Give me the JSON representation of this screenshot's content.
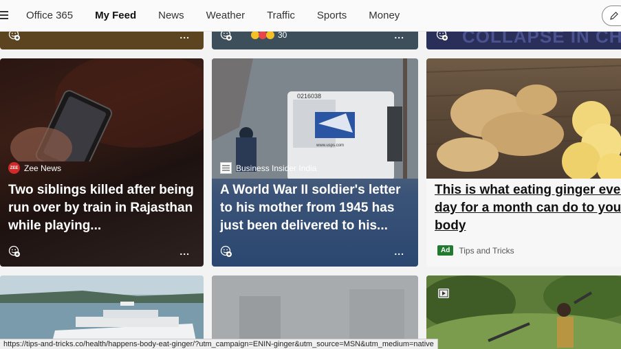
{
  "nav": {
    "items": [
      {
        "label": "Office 365",
        "active": false
      },
      {
        "label": "My Feed",
        "active": true
      },
      {
        "label": "News",
        "active": false
      },
      {
        "label": "Weather",
        "active": false
      },
      {
        "label": "Traffic",
        "active": false
      },
      {
        "label": "Sports",
        "active": false
      },
      {
        "label": "Money",
        "active": false
      }
    ]
  },
  "top_row": {
    "card2_reactions": "30",
    "card3_text": "COLLAPSE IN CHI"
  },
  "cards": [
    {
      "source": "Zee News",
      "source_logo": "ZEE",
      "headline": "Two siblings killed after being run over by train in Rajasthan while playing..."
    },
    {
      "source": "Business Insider India",
      "source_logo": "BI",
      "headline": "A World War II soldier's letter to his mother from 1945 has just been delivered to his..."
    },
    {
      "headline": "This is what eating ginger every day for a month can do to your body",
      "ad_label": "Ad",
      "ad_source": "Tips and Tricks"
    }
  ],
  "truck_text": "0216038",
  "truck_url": "www.usps.com",
  "more_label": "...",
  "statusbar": {
    "url": "https://tips-and-tricks.co/health/happens-body-eat-ginger/?utm_campaign=ENIN-ginger&utm_source=MSN&utm_medium=native"
  },
  "colors": {
    "ad_green": "#217a2f",
    "zee_red": "#d12a2a",
    "usps_blue": "#2a55a3"
  }
}
